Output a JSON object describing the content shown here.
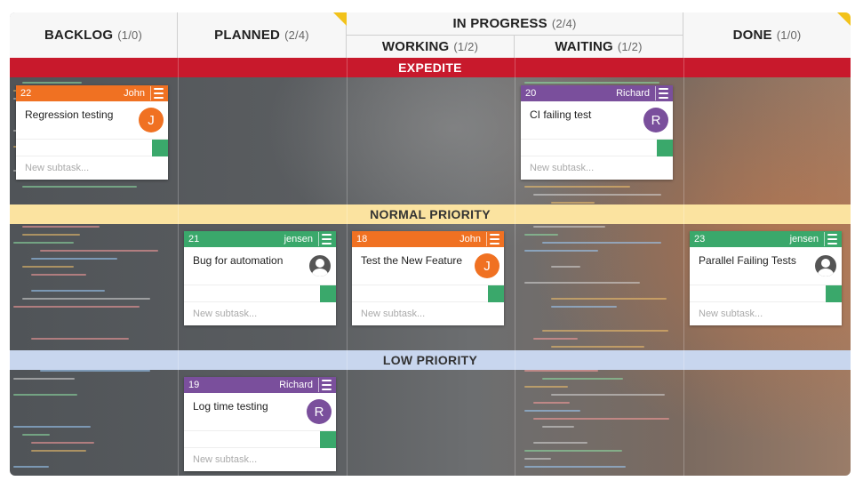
{
  "header": {
    "backlog": {
      "label": "BACKLOG",
      "count": "(1/0)"
    },
    "planned": {
      "label": "PLANNED",
      "count": "(2/4)"
    },
    "in_progress": {
      "label": "IN PROGRESS",
      "count": "(2/4)"
    },
    "working": {
      "label": "WORKING",
      "count": "(1/2)"
    },
    "waiting": {
      "label": "WAITING",
      "count": "(1/2)"
    },
    "done": {
      "label": "DONE",
      "count": "(1/0)"
    }
  },
  "lanes": {
    "expedite": {
      "label": "EXPEDITE",
      "color": "#c8192c",
      "text_color": "#ffffff"
    },
    "normal": {
      "label": "NORMAL PRIORITY",
      "color": "#fbe3a0",
      "text_color": "#333333"
    },
    "low": {
      "label": "LOW PRIORITY",
      "color": "#c8d6ee",
      "text_color": "#333333"
    }
  },
  "colors": {
    "orange": "#f07122",
    "purple": "#7a4f9c",
    "green": "#3aa86b",
    "corner_accent": "#f2c21b"
  },
  "cards": {
    "c22": {
      "id": "22",
      "owner": "John",
      "title": "Regression testing",
      "avatar": "J",
      "subtask_placeholder": "New subtask...",
      "header_color": "orange"
    },
    "c20": {
      "id": "20",
      "owner": "Richard",
      "title": "CI failing test",
      "avatar": "R",
      "subtask_placeholder": "New subtask...",
      "header_color": "purple"
    },
    "c21": {
      "id": "21",
      "owner": "jensen",
      "title": "Bug for automation",
      "avatar": "person-icon",
      "subtask_placeholder": "New subtask...",
      "header_color": "green"
    },
    "c18": {
      "id": "18",
      "owner": "John",
      "title": "Test the New Feature",
      "avatar": "J",
      "subtask_placeholder": "New subtask...",
      "header_color": "orange"
    },
    "c23": {
      "id": "23",
      "owner": "jensen",
      "title": "Parallel Failing Tests",
      "avatar": "person-icon",
      "subtask_placeholder": "New subtask...",
      "header_color": "green"
    },
    "c19": {
      "id": "19",
      "owner": "Richard",
      "title": "Log time testing",
      "avatar": "R",
      "subtask_placeholder": "New subtask...",
      "header_color": "purple"
    }
  }
}
